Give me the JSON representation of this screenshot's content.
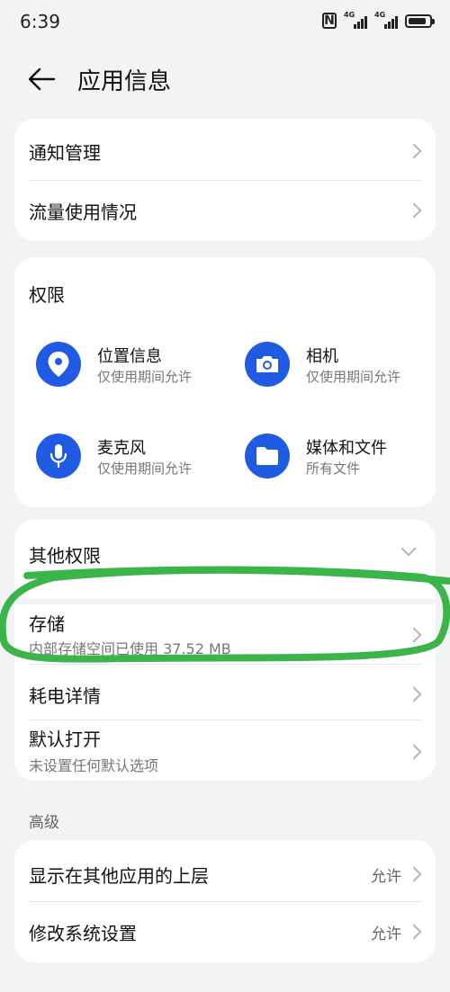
{
  "status_bar": {
    "time": "6:39",
    "network_1": "4G",
    "network_2": "4G",
    "battery_level": 0.85
  },
  "header": {
    "title": "应用信息",
    "back_icon": "arrow-left-icon"
  },
  "card1": {
    "items": [
      {
        "label": "通知管理"
      },
      {
        "label": "流量使用情况"
      }
    ]
  },
  "permissions": {
    "title": "权限",
    "items": [
      {
        "name": "位置信息",
        "desc": "仅使用期间允许",
        "icon": "location-pin-icon"
      },
      {
        "name": "相机",
        "desc": "仅使用期间允许",
        "icon": "camera-icon"
      },
      {
        "name": "麦克风",
        "desc": "仅使用期间允许",
        "icon": "microphone-icon"
      },
      {
        "name": "媒体和文件",
        "desc": "所有文件",
        "icon": "folder-icon"
      }
    ]
  },
  "other_permissions": {
    "label": "其他权限"
  },
  "card3": {
    "storage": {
      "label": "存储",
      "sub": "内部存储空间已使用 37.52 MB"
    },
    "battery": {
      "label": "耗电详情"
    },
    "default_open": {
      "label": "默认打开",
      "sub": "未设置任何默认选项"
    }
  },
  "advanced": {
    "section_label": "高级",
    "items": [
      {
        "label": "显示在其他应用的上层",
        "value": "允许"
      },
      {
        "label": "修改系统设置",
        "value": "允许"
      }
    ]
  },
  "colors": {
    "accent": "#1f5ce3",
    "annotation": "#3bb54a",
    "background": "#f1f3f5"
  }
}
